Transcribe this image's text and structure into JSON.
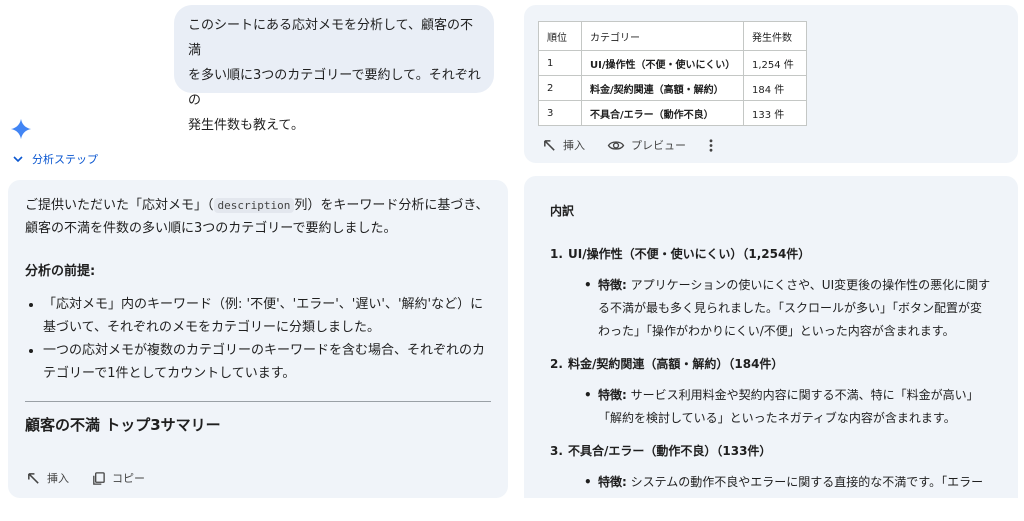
{
  "user_message": {
    "line1": "このシートにある応対メモを分析して、顧客の不満",
    "line2": "を多い順に3つのカテゴリーで要約して。それぞれの",
    "line3": "発生件数も教えて。"
  },
  "analysis_steps_label": "分析ステップ",
  "answer": {
    "intro_part1": "ご提供いただいた「応対メモ」（",
    "intro_code": "description",
    "intro_part2": "列）をキーワード分析に基づき、",
    "intro_line2": "顧客の不満を件数の多い順に3つのカテゴリーで要約しました。",
    "prereq_title": "分析の前提:",
    "bullets": [
      "「応対メモ」内のキーワード（例: '不便'、'エラー'、'遅い'、'解約'など）に基づいて、それぞれのメモをカテゴリーに分類しました。",
      "一つの応対メモが複数のカテゴリーのキーワードを含む場合、それぞれのカテゴリーで1件としてカウントしています。"
    ],
    "summary_title": "顧客の不満 トップ3サマリー",
    "insert_label": "挿入",
    "copy_label": "コピー"
  },
  "table": {
    "headers": [
      "順位",
      "カテゴリー",
      "発生件数"
    ],
    "rows": [
      [
        "1",
        "UI/操作性（不便・使いにくい）",
        "1,254 件"
      ],
      [
        "2",
        "料金/契約関連（高額・解約）",
        "184 件"
      ],
      [
        "3",
        "不具合/エラー（動作不良）",
        "133 件"
      ]
    ],
    "insert_label": "挿入",
    "preview_label": "プレビュー"
  },
  "breakdown": {
    "title": "内訳",
    "items": [
      {
        "num": "1.",
        "heading": "UI/操作性（不便・使いにくい）（1,254件）",
        "label": "特徴:",
        "text": " アプリケーションの使いにくさや、UI変更後の操作性の悪化に関する不満が最も多く見られました。「スクロールが多い」「ボタン配置が変わった」「操作がわかりにくい/不便」といった内容が含まれます。"
      },
      {
        "num": "2.",
        "heading": "料金/契約関連（高額・解約）（184件）",
        "label": "特徴:",
        "text": " サービス利用料金や契約内容に関する不満、特に「料金が高い」「解約を検討している」といったネガティブな内容が含まれます。"
      },
      {
        "num": "3.",
        "heading": "不具合/エラー（動作不良）（133件）",
        "label": "特徴:",
        "text": " システムの動作不良やエラーに関する直接的な不満です。「エラーで動かない」「画面が表示されない」「不具合が発生している」といった"
      }
    ]
  },
  "colors": {
    "accent": "#0b57d0",
    "card": "#f0f4f9",
    "bubble": "#e9eef6"
  }
}
